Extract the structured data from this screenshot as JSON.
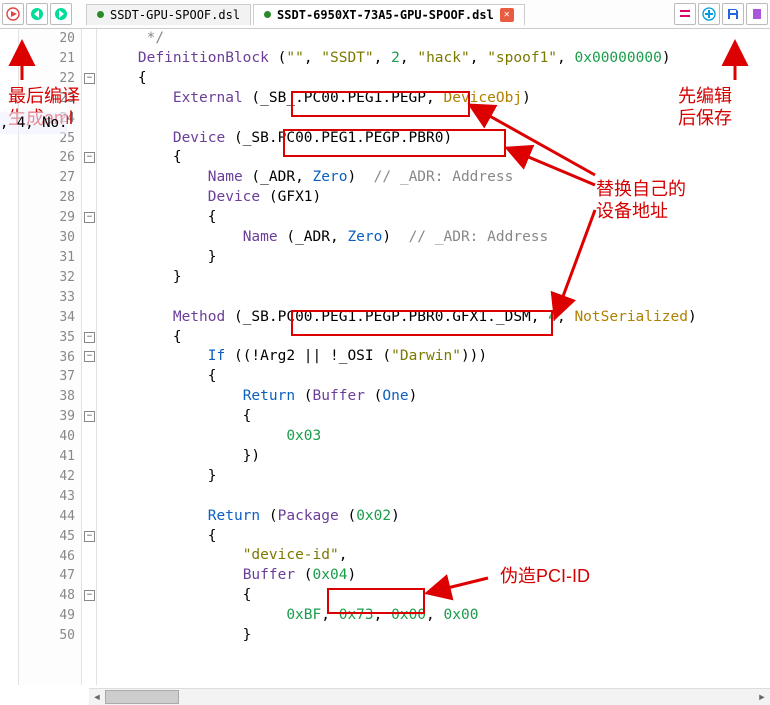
{
  "toolbar": {
    "run_icon": "run",
    "back_icon": "back",
    "fwd_icon": "fwd",
    "diff_icon": "diff",
    "add_icon": "add",
    "save_icon": "save",
    "book_icon": "book"
  },
  "tabs": [
    {
      "label": "SSDT-GPU-SPOOF.dsl",
      "active": false
    },
    {
      "label": "SSDT-6950XT-73A5-GPU-SPOOF.dsl",
      "active": true
    }
  ],
  "line_start": 20,
  "lines": [
    {
      "n": 20,
      "raw": "     */",
      "seg": [
        {
          "c": "cm",
          "t": "     */"
        }
      ]
    },
    {
      "n": 21,
      "raw": "    DefinitionBlock (\"\", \"SSDT\", 2, \"hack\", \"spoof1\", 0x00000000)",
      "seg": [
        {
          "c": "",
          "t": "    "
        },
        {
          "c": "fn",
          "t": "DefinitionBlock"
        },
        {
          "c": "",
          "t": " ("
        },
        {
          "c": "str",
          "t": "\"\""
        },
        {
          "c": "",
          "t": ", "
        },
        {
          "c": "str",
          "t": "\"SSDT\""
        },
        {
          "c": "",
          "t": ", "
        },
        {
          "c": "num",
          "t": "2"
        },
        {
          "c": "",
          "t": ", "
        },
        {
          "c": "str",
          "t": "\"hack\""
        },
        {
          "c": "",
          "t": ", "
        },
        {
          "c": "str",
          "t": "\"spoof1\""
        },
        {
          "c": "",
          "t": ", "
        },
        {
          "c": "num",
          "t": "0x00000000"
        },
        {
          "c": "",
          "t": ")"
        }
      ]
    },
    {
      "n": 22,
      "fold": "-",
      "raw": "    {",
      "seg": [
        {
          "c": "",
          "t": "    {"
        }
      ]
    },
    {
      "n": 23,
      "raw": "        External (_SB_.PC00.PEG1.PEGP, DeviceObj)",
      "seg": [
        {
          "c": "",
          "t": "        "
        },
        {
          "c": "fn",
          "t": "External"
        },
        {
          "c": "",
          "t": " (_SB_.PC00.PEG1.PEGP, "
        },
        {
          "c": "arg",
          "t": "DeviceObj"
        },
        {
          "c": "",
          "t": ")"
        }
      ]
    },
    {
      "n": 24,
      "raw": "",
      "seg": [
        {
          "c": "",
          "t": ""
        }
      ]
    },
    {
      "n": 25,
      "raw": "        Device (_SB.PC00.PEG1.PEGP.PBR0)",
      "seg": [
        {
          "c": "",
          "t": "        "
        },
        {
          "c": "fn",
          "t": "Device"
        },
        {
          "c": "",
          "t": " (_SB.PC00.PEG1.PEGP.PBR0)"
        }
      ]
    },
    {
      "n": 26,
      "fold": "-",
      "raw": "        {",
      "seg": [
        {
          "c": "",
          "t": "        {"
        }
      ]
    },
    {
      "n": 27,
      "raw": "            Name (_ADR, Zero)  // _ADR: Address",
      "seg": [
        {
          "c": "",
          "t": "            "
        },
        {
          "c": "fn",
          "t": "Name"
        },
        {
          "c": "",
          "t": " (_ADR, "
        },
        {
          "c": "kw",
          "t": "Zero"
        },
        {
          "c": "",
          "t": ")  "
        },
        {
          "c": "cm",
          "t": "// _ADR: Address"
        }
      ]
    },
    {
      "n": 28,
      "raw": "            Device (GFX1)",
      "seg": [
        {
          "c": "",
          "t": "            "
        },
        {
          "c": "fn",
          "t": "Device"
        },
        {
          "c": "",
          "t": " (GFX1)"
        }
      ]
    },
    {
      "n": 29,
      "fold": "-",
      "raw": "            {",
      "seg": [
        {
          "c": "",
          "t": "            {"
        }
      ]
    },
    {
      "n": 30,
      "raw": "                Name (_ADR, Zero)  // _ADR: Address",
      "seg": [
        {
          "c": "",
          "t": "                "
        },
        {
          "c": "fn",
          "t": "Name"
        },
        {
          "c": "",
          "t": " (_ADR, "
        },
        {
          "c": "kw",
          "t": "Zero"
        },
        {
          "c": "",
          "t": ")  "
        },
        {
          "c": "cm",
          "t": "// _ADR: Address"
        }
      ]
    },
    {
      "n": 31,
      "raw": "            }",
      "seg": [
        {
          "c": "",
          "t": "            }"
        }
      ]
    },
    {
      "n": 32,
      "raw": "        }",
      "seg": [
        {
          "c": "",
          "t": "        }"
        }
      ]
    },
    {
      "n": 33,
      "raw": "",
      "seg": [
        {
          "c": "",
          "t": ""
        }
      ]
    },
    {
      "n": 34,
      "raw": "        Method (_SB.PC00.PEG1.PEGP.PBR0.GFX1._DSM, 4, NotSerialized)",
      "seg": [
        {
          "c": "",
          "t": "        "
        },
        {
          "c": "fn",
          "t": "Method"
        },
        {
          "c": "",
          "t": " (_SB.PC00.PEG1.PEGP.PBR0.GFX1._DSM, "
        },
        {
          "c": "num",
          "t": "4"
        },
        {
          "c": "",
          "t": ", "
        },
        {
          "c": "arg",
          "t": "NotSerialized"
        },
        {
          "c": "",
          "t": ")"
        }
      ]
    },
    {
      "n": 35,
      "fold": "-",
      "raw": "        {",
      "seg": [
        {
          "c": "",
          "t": "        {"
        }
      ]
    },
    {
      "n": 36,
      "fold": "-",
      "raw": "            If ((!Arg2 || !_OSI (\"Darwin\")))",
      "seg": [
        {
          "c": "",
          "t": "            "
        },
        {
          "c": "kw",
          "t": "If"
        },
        {
          "c": "",
          "t": " ((!Arg2 || !_OSI ("
        },
        {
          "c": "str",
          "t": "\"Darwin\""
        },
        {
          "c": "",
          "t": ")))"
        }
      ]
    },
    {
      "n": 37,
      "raw": "            {",
      "seg": [
        {
          "c": "",
          "t": "            {"
        }
      ]
    },
    {
      "n": 38,
      "raw": "                Return (Buffer (One)",
      "seg": [
        {
          "c": "",
          "t": "                "
        },
        {
          "c": "kw",
          "t": "Return"
        },
        {
          "c": "",
          "t": " ("
        },
        {
          "c": "fn",
          "t": "Buffer"
        },
        {
          "c": "",
          "t": " ("
        },
        {
          "c": "kw",
          "t": "One"
        },
        {
          "c": "",
          "t": ")"
        }
      ]
    },
    {
      "n": 39,
      "fold": "-",
      "raw": "                {",
      "seg": [
        {
          "c": "",
          "t": "                {"
        }
      ]
    },
    {
      "n": 40,
      "raw": "                     0x03",
      "seg": [
        {
          "c": "",
          "t": "                     "
        },
        {
          "c": "num",
          "t": "0x03"
        }
      ]
    },
    {
      "n": 41,
      "raw": "                })",
      "seg": [
        {
          "c": "",
          "t": "                })"
        }
      ]
    },
    {
      "n": 42,
      "raw": "            }",
      "seg": [
        {
          "c": "",
          "t": "            }"
        }
      ]
    },
    {
      "n": 43,
      "raw": "",
      "seg": [
        {
          "c": "",
          "t": ""
        }
      ]
    },
    {
      "n": 44,
      "raw": "            Return (Package (0x02)",
      "seg": [
        {
          "c": "",
          "t": "            "
        },
        {
          "c": "kw",
          "t": "Return"
        },
        {
          "c": "",
          "t": " ("
        },
        {
          "c": "fn",
          "t": "Package"
        },
        {
          "c": "",
          "t": " ("
        },
        {
          "c": "num",
          "t": "0x02"
        },
        {
          "c": "",
          "t": ")"
        }
      ]
    },
    {
      "n": 45,
      "fold": "-",
      "raw": "            {",
      "seg": [
        {
          "c": "",
          "t": "            {"
        }
      ]
    },
    {
      "n": 46,
      "raw": "                \"device-id\",",
      "seg": [
        {
          "c": "",
          "t": "                "
        },
        {
          "c": "str",
          "t": "\"device-id\""
        },
        {
          "c": "",
          "t": ","
        }
      ]
    },
    {
      "n": 47,
      "raw": "                Buffer (0x04)",
      "seg": [
        {
          "c": "",
          "t": "                "
        },
        {
          "c": "fn",
          "t": "Buffer"
        },
        {
          "c": "",
          "t": " ("
        },
        {
          "c": "num",
          "t": "0x04"
        },
        {
          "c": "",
          "t": ")"
        }
      ]
    },
    {
      "n": 48,
      "fold": "-",
      "raw": "                {",
      "seg": [
        {
          "c": "",
          "t": "                {"
        }
      ]
    },
    {
      "n": 49,
      "raw": "                     0xBF, 0x73, 0x00, 0x00",
      "seg": [
        {
          "c": "",
          "t": "                     "
        },
        {
          "c": "num",
          "t": "0xBF"
        },
        {
          "c": "",
          "t": ", "
        },
        {
          "c": "num",
          "t": "0x73"
        },
        {
          "c": "",
          "t": ", "
        },
        {
          "c": "num",
          "t": "0x00"
        },
        {
          "c": "",
          "t": ", "
        },
        {
          "c": "num",
          "t": "0x00"
        }
      ]
    },
    {
      "n": 50,
      "raw": "                }",
      "seg": [
        {
          "c": "",
          "t": "                }"
        }
      ]
    }
  ],
  "annotations": {
    "compile": "最后编译\n生成aml",
    "edit_save": "先编辑\n后保存",
    "replace_addr": "替换自己的\n设备地址",
    "fake_pci": "伪造PCI-ID"
  },
  "hidden_text": ", 4, No."
}
